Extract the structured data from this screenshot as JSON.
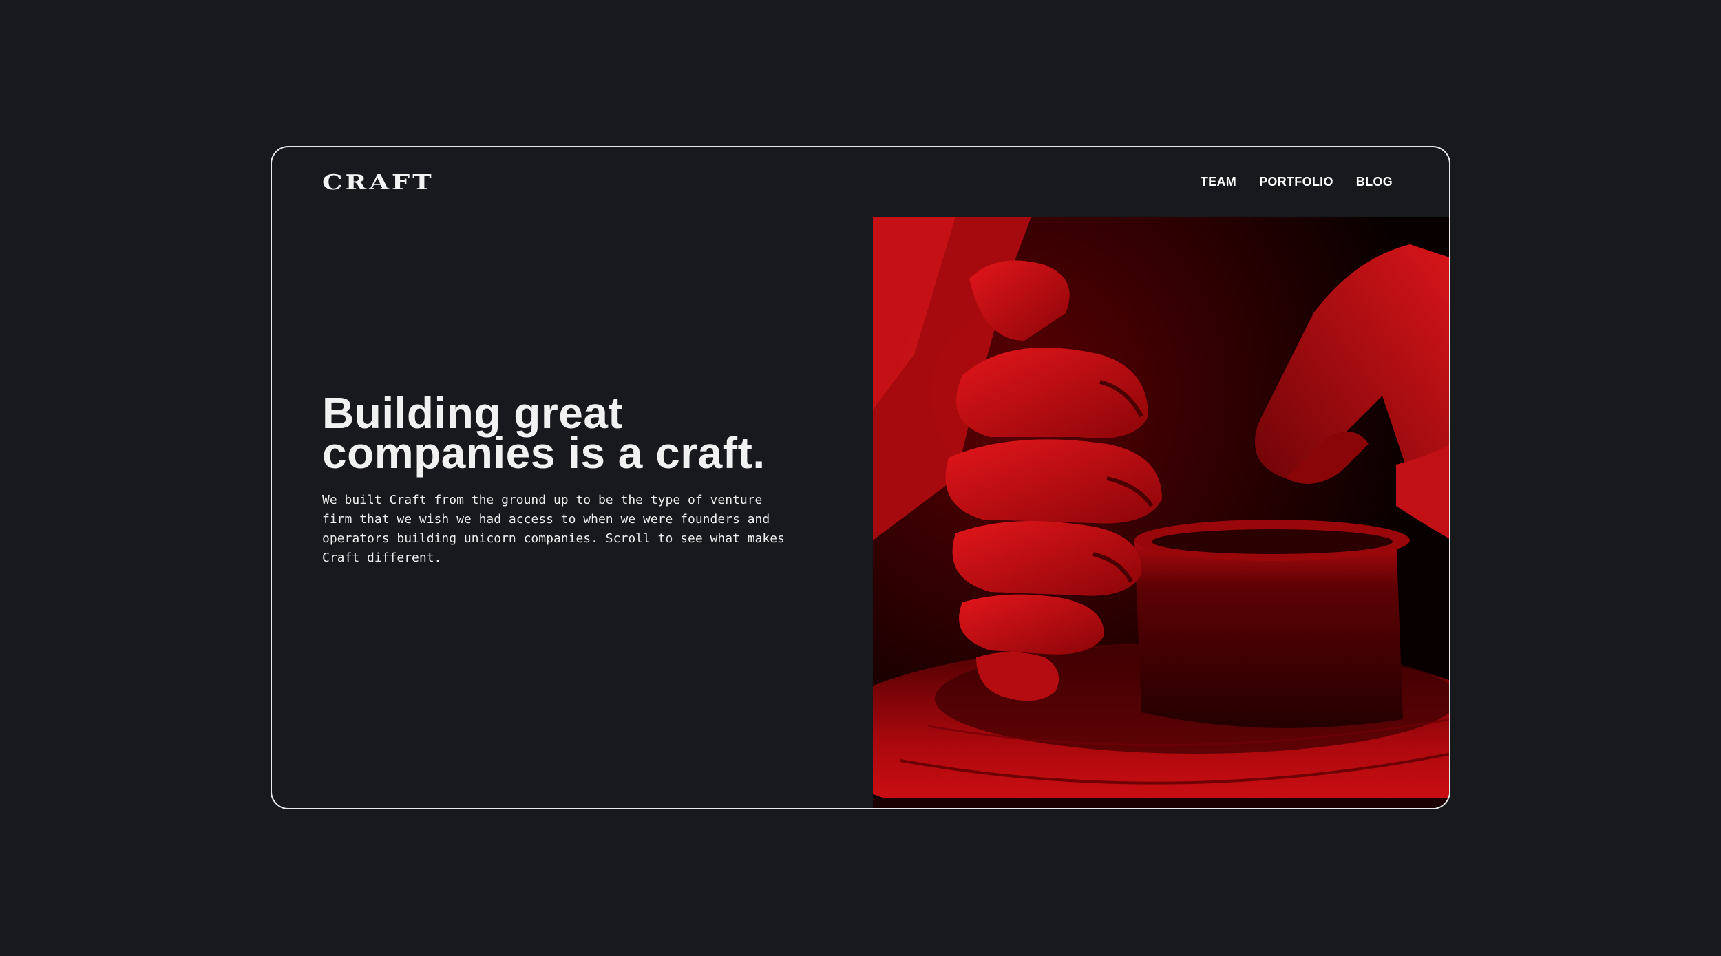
{
  "brand": {
    "logo_text": "CRAFT"
  },
  "nav": {
    "items": [
      {
        "label": "TEAM"
      },
      {
        "label": "PORTFOLIO"
      },
      {
        "label": "BLOG"
      }
    ]
  },
  "hero": {
    "headline_line1": "Building great",
    "headline_line2": "companies is a craft.",
    "body": "We built Craft from the ground up to be the type of venture firm that we wish we had access to when we were founders and operators building unicorn companies. Scroll to see what makes Craft different."
  },
  "colors": {
    "background": "#18191d",
    "frame_border": "#e9e9e9",
    "accent_red": "#d01116",
    "text": "#f1f1f1"
  }
}
